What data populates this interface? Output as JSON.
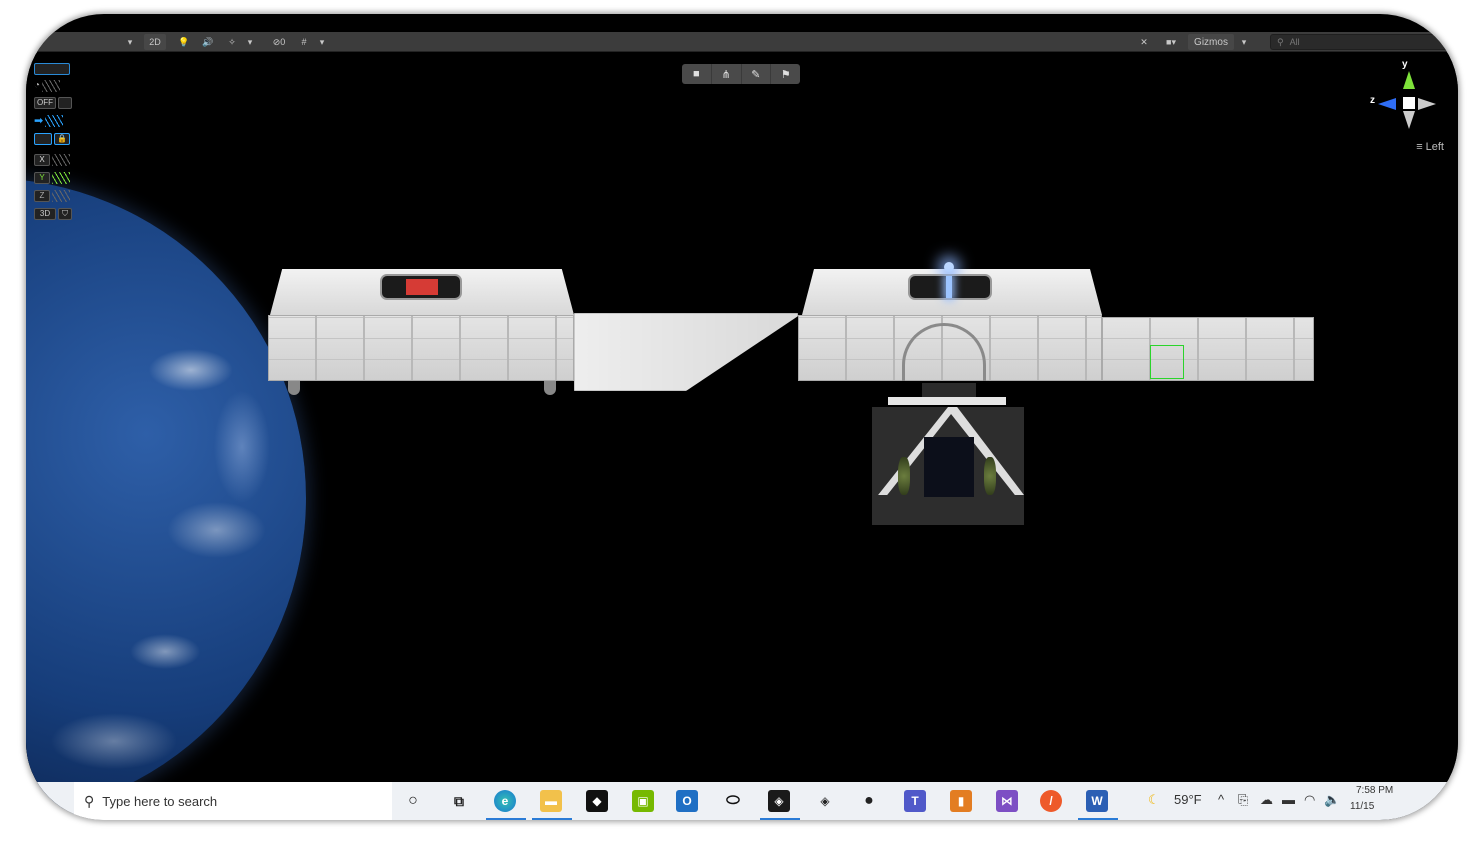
{
  "toolbar": {
    "mode_2d": "2D",
    "hidden_count": "0",
    "gizmos_label": "Gizmos",
    "search_placeholder": "All"
  },
  "scene_panel": {
    "off_label": "OFF",
    "axis_x": "X",
    "axis_y": "Y",
    "axis_z": "Z",
    "mode_3d": "3D"
  },
  "gizmo": {
    "y_label": "y",
    "z_label": "z",
    "view_label": "Left"
  },
  "taskbar": {
    "search_placeholder": "Type here to search",
    "weather": "59°F",
    "time": "7:58 PM",
    "date": "11/15"
  },
  "colors": {
    "toolbar_bg": "#3c3c3c",
    "accent_blue": "#2a7bd6",
    "axis_x": "#e04040",
    "axis_y": "#7ee23a",
    "axis_z": "#2f6df5"
  },
  "icons": {
    "overlay_tools": [
      "cube-icon",
      "nodes-icon",
      "brush-icon",
      "flag-icon"
    ],
    "taskbar_apps": [
      "cortana-icon",
      "task-view-icon",
      "edge-icon",
      "file-explorer-icon",
      "app-icon",
      "nvidia-icon",
      "outlook-icon",
      "oculus-icon",
      "unity-icon",
      "unity-hub-icon",
      "alienware-icon",
      "teams-icon",
      "app-orange-icon",
      "visual-studio-icon",
      "app-red-icon",
      "word-icon"
    ]
  }
}
